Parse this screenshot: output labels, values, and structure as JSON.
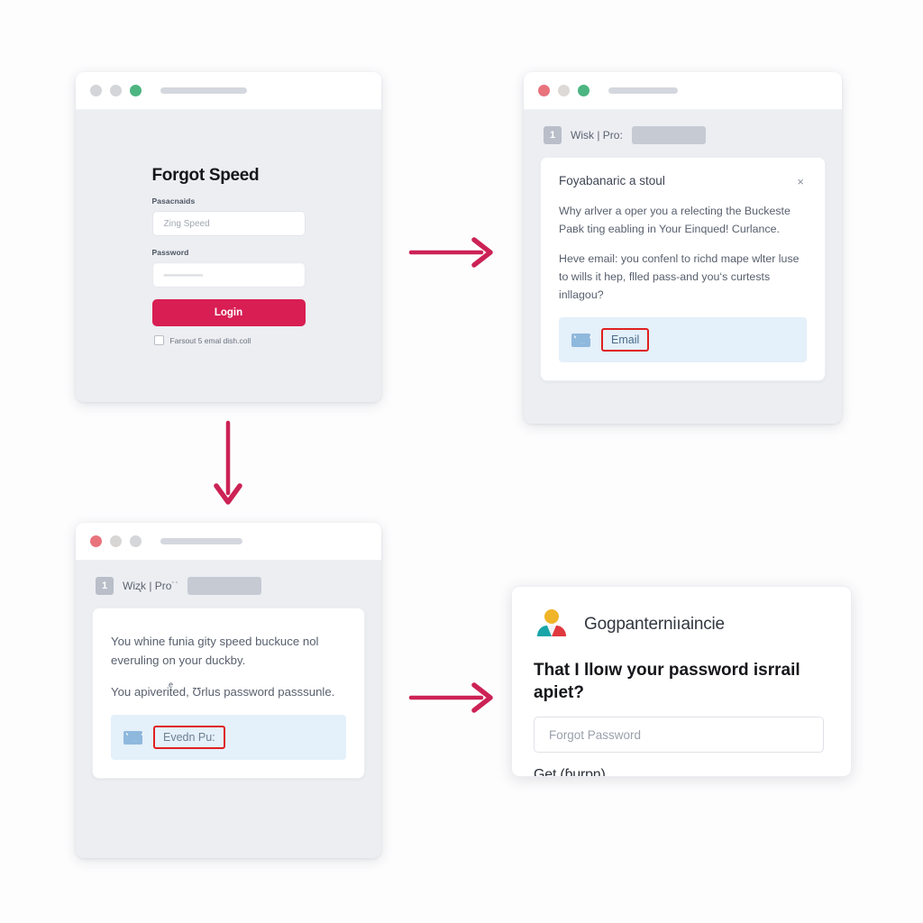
{
  "colors": {
    "accent": "#d81e53",
    "arrow": "#cc2255",
    "highlight_box": "#e02020",
    "mail_band": "#e4f0fa",
    "window_bg": "#eceef2"
  },
  "panels": {
    "login": {
      "name": "Forgot password login window",
      "traffic_lights": [
        "#d3d5d8",
        "#d3d5d8",
        "#4cb581"
      ],
      "title": "Forgot Speed",
      "username_label": "Pasacnaids",
      "username_value": "Zing Speed",
      "password_label": "Password",
      "password_value": "••••••••••••••••••",
      "login_button": "Login",
      "checkbox_label": "Farsout 5 emal dish.coll"
    },
    "dialog": {
      "name": "Reset instructions dialog window",
      "traffic_lights": [
        "#e8737d",
        "#ddd9d6",
        "#4cb581"
      ],
      "step_number": "1",
      "step_label": "Wisk | Pro:",
      "card_title": "Foyabanaric a stoul",
      "paragraph_1": "Why arlver a oper you a relecting the Buckeste Paʙk ting eabling in Your Einqued! Curlance.",
      "paragraph_2": "Heve email: you confenl to richd mape wlter luse to wills it hep, flled pass-and you‘s curtests inllagou?",
      "mail_link": "Email"
    },
    "confirm": {
      "name": "Sent confirmation window",
      "traffic_lights": [
        "#e8737d",
        "#d8d6d4",
        "#d5d6d9"
      ],
      "step_number": "1",
      "step_label": "Wiʐk | Pro˙˙",
      "paragraph_1": "You whine funia gity speed buckuce nol everuling on your duckby.",
      "paragraph_2": "You apiveritͤed, Ʊrlus password passsunle.",
      "mail_link": "Evedn Pu:"
    },
    "prompt": {
      "name": "Account recovery prompt card",
      "brand": "Gogpanterniıaincie",
      "question": "That I lloıw your password isrrail apiet?",
      "input_placeholder": "Forgot Password",
      "footer": "Get (ɓurɒŋ)"
    }
  },
  "arrows": [
    {
      "name": "arrow-login-to-dialog",
      "direction": "right"
    },
    {
      "name": "arrow-login-to-confirm",
      "direction": "down"
    },
    {
      "name": "arrow-confirm-to-prompt",
      "direction": "right"
    }
  ],
  "icons": {
    "mail": "mail-icon",
    "close": "×",
    "people": "people-group-icon"
  }
}
